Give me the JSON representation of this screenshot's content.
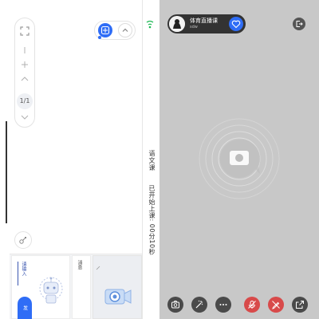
{
  "host": {
    "name": "体育直播课",
    "id": "sdw"
  },
  "whiteboard": {
    "page_indicator": "1/1",
    "subject_label": "语文课",
    "duration_label": "已开始上课: 00分10秒"
  },
  "panel": {
    "input_placeholder": "请输入",
    "blue_tab_label": "发",
    "text_card_label": "消息"
  },
  "colors": {
    "accent": "#2f6df6",
    "video_bg": "#c8c8c8",
    "control_dark": "#4a4a4a",
    "control_red": "#d84a4a",
    "signal_green": "#1db954"
  },
  "icons": {
    "fullscreen": "fullscreen-icon",
    "minus": "minus-icon",
    "plus": "plus-icon",
    "chevron_up": "chevron-up-icon",
    "chevron_down": "chevron-down-icon",
    "loop": "loop-icon",
    "signal": "signal-icon",
    "tool": "tool-icon",
    "follow": "heart-add-icon",
    "exit": "exit-icon",
    "camera_switch": "camera-switch-icon",
    "effects": "magic-wand-icon",
    "more": "more-icon",
    "mic_off": "mic-off-icon",
    "pen_off": "pen-off-icon",
    "share": "share-icon"
  }
}
